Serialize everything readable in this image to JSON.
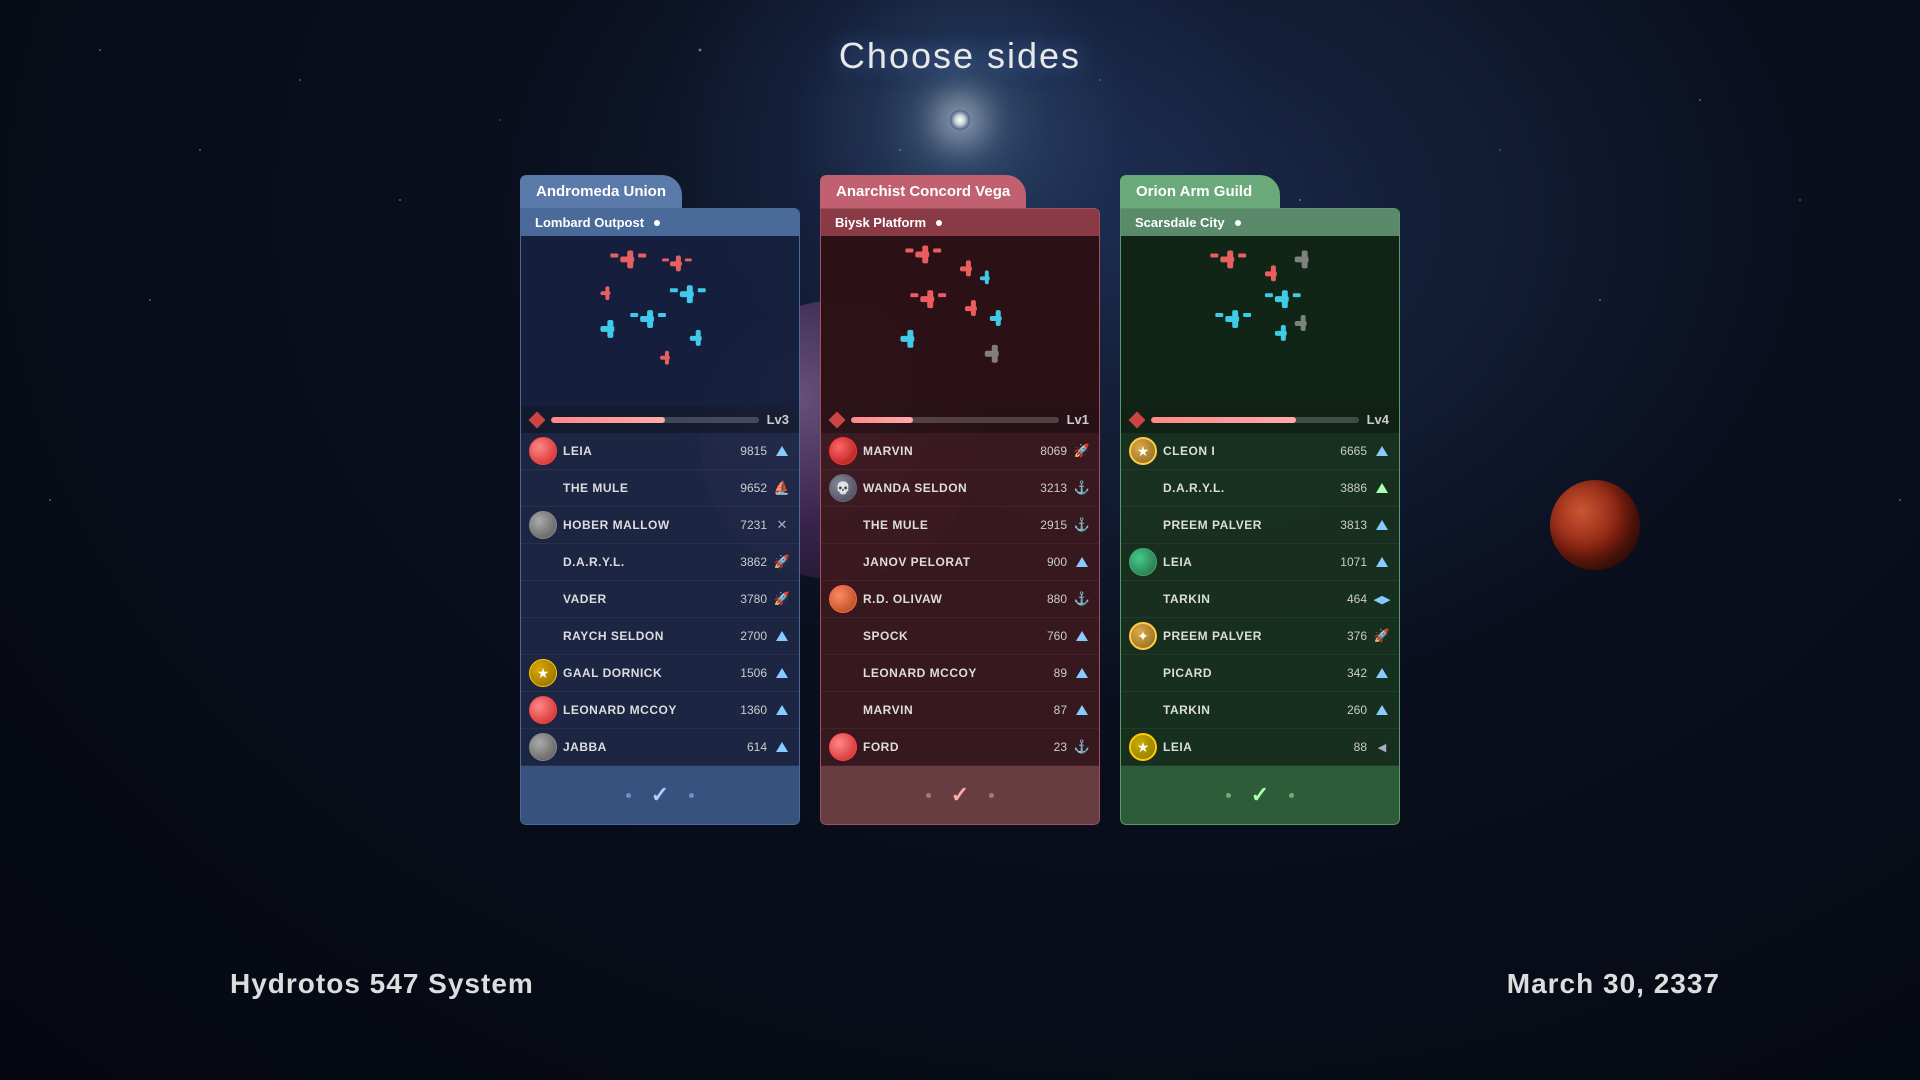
{
  "page": {
    "title": "Choose sides",
    "bottom_left": "Hydrotos 547 System",
    "bottom_right": "March 30, 2337"
  },
  "factions": [
    {
      "id": "andromeda",
      "name": "Andromeda Union",
      "location": "Lombard Outpost",
      "level": "Lv3",
      "level_pct": 55,
      "color_class": "andromeda",
      "players": [
        {
          "name": "LEIA",
          "score": "9815",
          "rank": "up",
          "has_avatar": true,
          "avatar_type": "red"
        },
        {
          "name": "THE MULE",
          "score": "9652",
          "rank": "ship",
          "has_avatar": false
        },
        {
          "name": "HOBER MALLOW",
          "score": "7231",
          "rank": "cross",
          "has_avatar": true,
          "avatar_type": "gray"
        },
        {
          "name": "D.A.R.Y.L.",
          "score": "3862",
          "rank": "ship2",
          "has_avatar": false
        },
        {
          "name": "VADER",
          "score": "3780",
          "rank": "ship2",
          "has_avatar": false
        },
        {
          "name": "RAYCH SELDON",
          "score": "2700",
          "rank": "up",
          "has_avatar": false
        },
        {
          "name": "GAAL DORNICK",
          "score": "1506",
          "rank": "up",
          "has_avatar": true,
          "avatar_type": "gold_star"
        },
        {
          "name": "LEONARD MCCOY",
          "score": "1360",
          "rank": "up",
          "has_avatar": true,
          "avatar_type": "red"
        },
        {
          "name": "JABBA",
          "score": "614",
          "rank": "up",
          "has_avatar": true,
          "avatar_type": "gray"
        }
      ],
      "btn_label": "✓"
    },
    {
      "id": "anarchist",
      "name": "Anarchist Concord Vega",
      "location": "Biysk Platform",
      "level": "Lv1",
      "level_pct": 30,
      "color_class": "anarchist",
      "players": [
        {
          "name": "MARVIN",
          "score": "8069",
          "rank": "ship2",
          "has_avatar": true,
          "avatar_type": "red_multi"
        },
        {
          "name": "WANDA SELDON",
          "score": "3213",
          "rank": "anchor",
          "has_avatar": true,
          "avatar_type": "skull"
        },
        {
          "name": "THE MULE",
          "score": "2915",
          "rank": "anchor",
          "has_avatar": false
        },
        {
          "name": "JANOV PELORAT",
          "score": "900",
          "rank": "up",
          "has_avatar": false
        },
        {
          "name": "R.D. OLIVAW",
          "score": "880",
          "rank": "ship3",
          "has_avatar": true,
          "avatar_type": "multi"
        },
        {
          "name": "SPOCK",
          "score": "760",
          "rank": "up",
          "has_avatar": false
        },
        {
          "name": "LEONARD MCCOY",
          "score": "89",
          "rank": "up",
          "has_avatar": false
        },
        {
          "name": "MARVIN",
          "score": "87",
          "rank": "up",
          "has_avatar": false
        },
        {
          "name": "FORD",
          "score": "23",
          "rank": "anchor2",
          "has_avatar": true,
          "avatar_type": "red"
        }
      ],
      "btn_label": "✓"
    },
    {
      "id": "orion",
      "name": "Orion Arm Guild",
      "location": "Scarsdale City",
      "level": "Lv4",
      "level_pct": 70,
      "color_class": "orion",
      "players": [
        {
          "name": "CLEON I",
          "score": "6665",
          "rank": "up",
          "has_avatar": true,
          "avatar_type": "gold_badge"
        },
        {
          "name": "D.A.R.Y.L.",
          "score": "3886",
          "rank": "triangle_up",
          "has_avatar": false
        },
        {
          "name": "PREEM PALVER",
          "score": "3813",
          "rank": "up",
          "has_avatar": false
        },
        {
          "name": "LEIA",
          "score": "1071",
          "rank": "up",
          "has_avatar": true,
          "avatar_type": "green_sphere"
        },
        {
          "name": "TARKIN",
          "score": "464",
          "rank": "side",
          "has_avatar": false
        },
        {
          "name": "PREEM PALVER",
          "score": "376",
          "rank": "ship2",
          "has_avatar": true,
          "avatar_type": "gold_badge2"
        },
        {
          "name": "PICARD",
          "score": "342",
          "rank": "up",
          "has_avatar": false
        },
        {
          "name": "TARKIN",
          "score": "260",
          "rank": "up",
          "has_avatar": false
        },
        {
          "name": "LEIA",
          "score": "88",
          "rank": "side2",
          "has_avatar": true,
          "avatar_type": "gold_star2"
        }
      ],
      "btn_label": "✓"
    }
  ]
}
